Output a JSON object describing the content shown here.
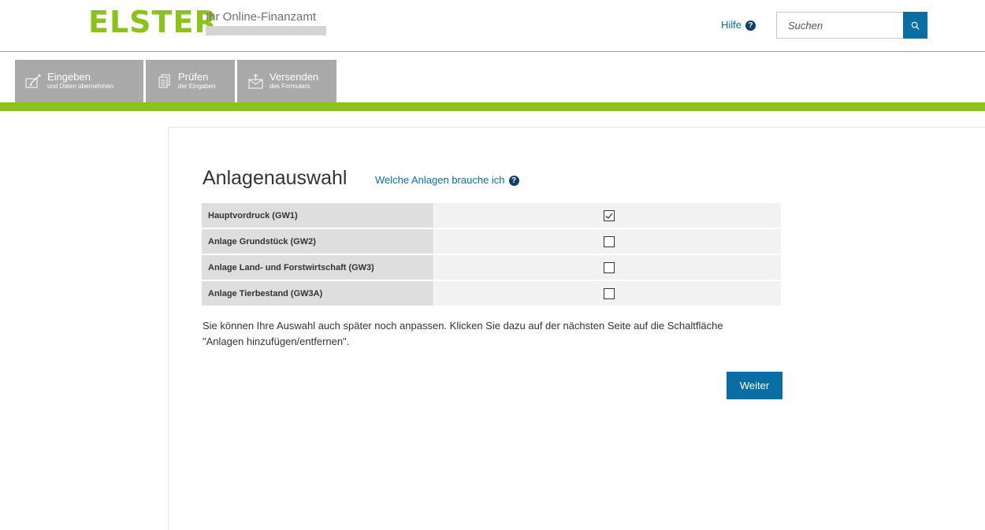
{
  "header": {
    "logo": "ELSTER",
    "tagline": "Ihr Online-Finanzamt",
    "help_label": "Hilfe",
    "search": {
      "placeholder": "Suchen",
      "value": ""
    }
  },
  "steps": [
    {
      "title": "Eingeben",
      "subtitle": "und Daten übernehmen",
      "icon": "edit-icon"
    },
    {
      "title": "Prüfen",
      "subtitle": "der Eingaben",
      "icon": "document-check-icon"
    },
    {
      "title": "Versenden",
      "subtitle": "des Formulars",
      "icon": "envelope-send-icon"
    }
  ],
  "main": {
    "title": "Anlagenauswahl",
    "help_link": "Welche Anlagen brauche ich",
    "rows": [
      {
        "label": "Hauptvordruck (GW1)",
        "checked": true
      },
      {
        "label": "Anlage Grundstück (GW2)",
        "checked": false
      },
      {
        "label": "Anlage Land- und Forstwirtschaft (GW3)",
        "checked": false
      },
      {
        "label": "Anlage Tierbestand (GW3A)",
        "checked": false
      }
    ],
    "hint_line1": "Sie können Ihre Auswahl auch später noch anpassen. Klicken Sie dazu auf der nächsten Seite auf die Schaltfläche",
    "hint_line2": "\"Anlagen hinzufügen/entfernen\".",
    "next_button": "Weiter"
  },
  "colors": {
    "brand_green": "#8cc21e",
    "link_blue": "#0a6ea4",
    "tab_gray": "#a9a9a9"
  }
}
